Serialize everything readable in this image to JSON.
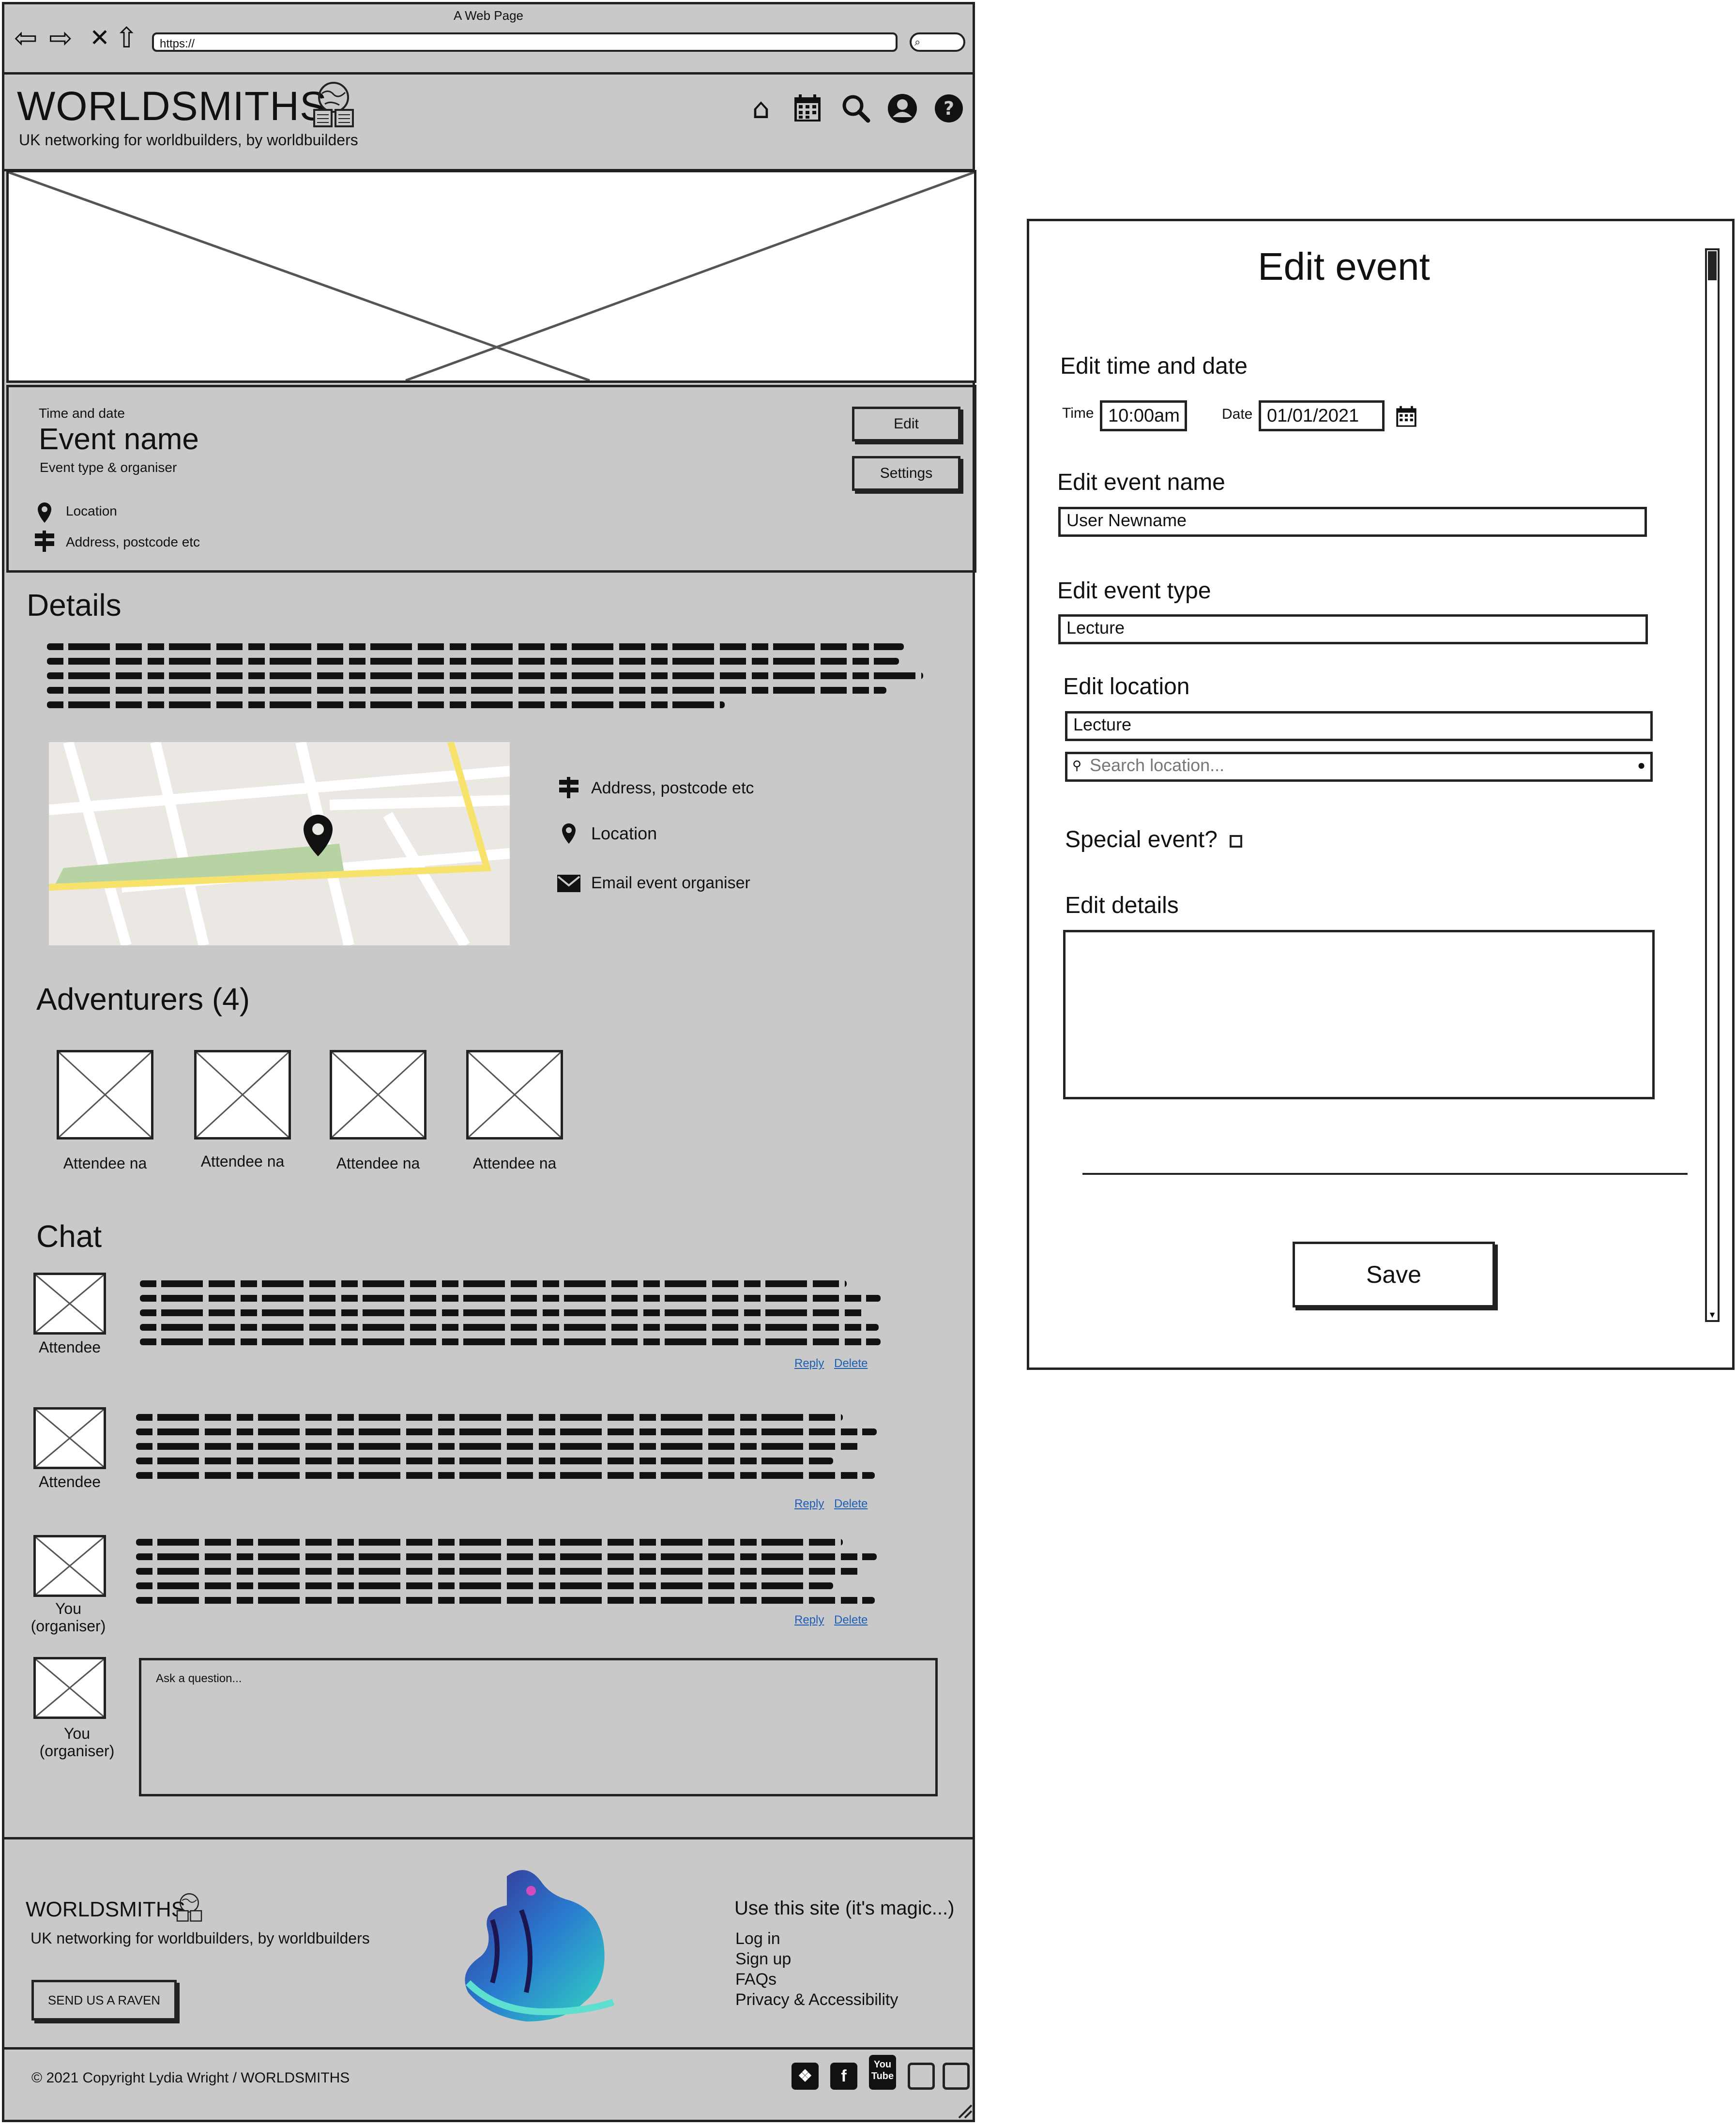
{
  "browser": {
    "title": "A Web Page",
    "url": "https://",
    "search_glyph": "⌕"
  },
  "header": {
    "logo": "WORLDSMITHS",
    "tagline": "UK networking for worldbuilders, by worldbuilders",
    "icons": [
      "home-icon",
      "calendar-icon",
      "search-icon",
      "user-icon",
      "help-icon"
    ]
  },
  "event": {
    "time_date": "Time and date",
    "name": "Event name",
    "type_organiser": "Event type & organiser",
    "location": "Location",
    "address": "Address, postcode etc",
    "edit_label": "Edit",
    "settings_label": "Settings"
  },
  "details": {
    "title": "Details",
    "address": "Address, postcode etc",
    "location": "Location",
    "email": "Email event organiser"
  },
  "adventurers": {
    "title": "Adventurers (4)",
    "attendees": [
      "Attendee na",
      "Attendee na",
      "Attendee na",
      "Attendee na"
    ]
  },
  "chat": {
    "title": "Chat",
    "reply": "Reply",
    "delete": "Delete",
    "posts": [
      {
        "author": "Attendee"
      },
      {
        "author": "Attendee"
      },
      {
        "author": "You\n(organiser)"
      }
    ],
    "composer_author": "You\n(organiser)",
    "ask_placeholder": "Ask a question..."
  },
  "footer": {
    "logo": "WORLDSMITHS",
    "tagline": "UK networking for worldbuilders, by worldbuilders",
    "raven_button": "SEND US A RAVEN",
    "links_title": "Use this site (it's magic...)",
    "links": [
      "Log in",
      "Sign up",
      "FAQs",
      "Privacy & Accessibility"
    ],
    "copyright": "© 2021 Copyright Lydia Wright / WORLDSMITHS",
    "youtube_label": "You Tube"
  },
  "modal": {
    "title": "Edit event",
    "time_date_heading": "Edit time and date",
    "time_label": "Time",
    "time_value": "10:00am",
    "date_label": "Date",
    "date_value": "01/01/2021",
    "name_heading": "Edit event name",
    "name_value": "User Newname",
    "type_heading": "Edit event type",
    "type_value": "Lecture",
    "location_heading": "Edit location",
    "location_value": "Lecture",
    "location_search_placeholder": "Search location...",
    "special_event_label": "Special event?",
    "details_heading": "Edit details",
    "save_label": "Save"
  }
}
